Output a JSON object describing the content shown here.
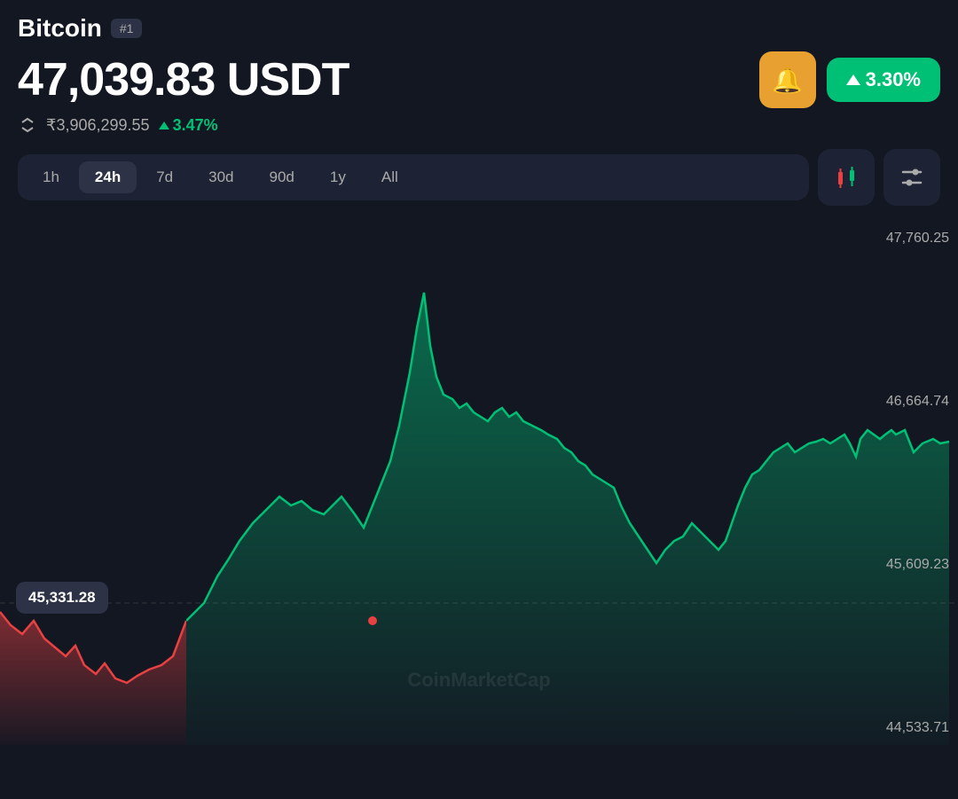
{
  "header": {
    "coin_name": "Bitcoin",
    "rank": "#1",
    "price": "47,039.83 USDT",
    "volume": "₹3,906,299.55",
    "volume_change": "3.47%",
    "change_pct": "3.30%",
    "bell_icon": "🔔",
    "rank_label": "#1"
  },
  "timeframes": {
    "options": [
      "1h",
      "24h",
      "7d",
      "30d",
      "90d",
      "1y",
      "All"
    ],
    "active": "24h"
  },
  "chart": {
    "price_high": "47,760.25",
    "price_mid1": "46,664.74",
    "price_mid2": "45,609.23",
    "price_low": "44,533.71",
    "tooltip_price": "45,331.28",
    "watermark": "CoinMarketCap"
  },
  "buttons": {
    "bell_label": "🔔",
    "change_label": "3.30%",
    "candlestick_icon": "candlestick",
    "filter_icon": "filter"
  }
}
